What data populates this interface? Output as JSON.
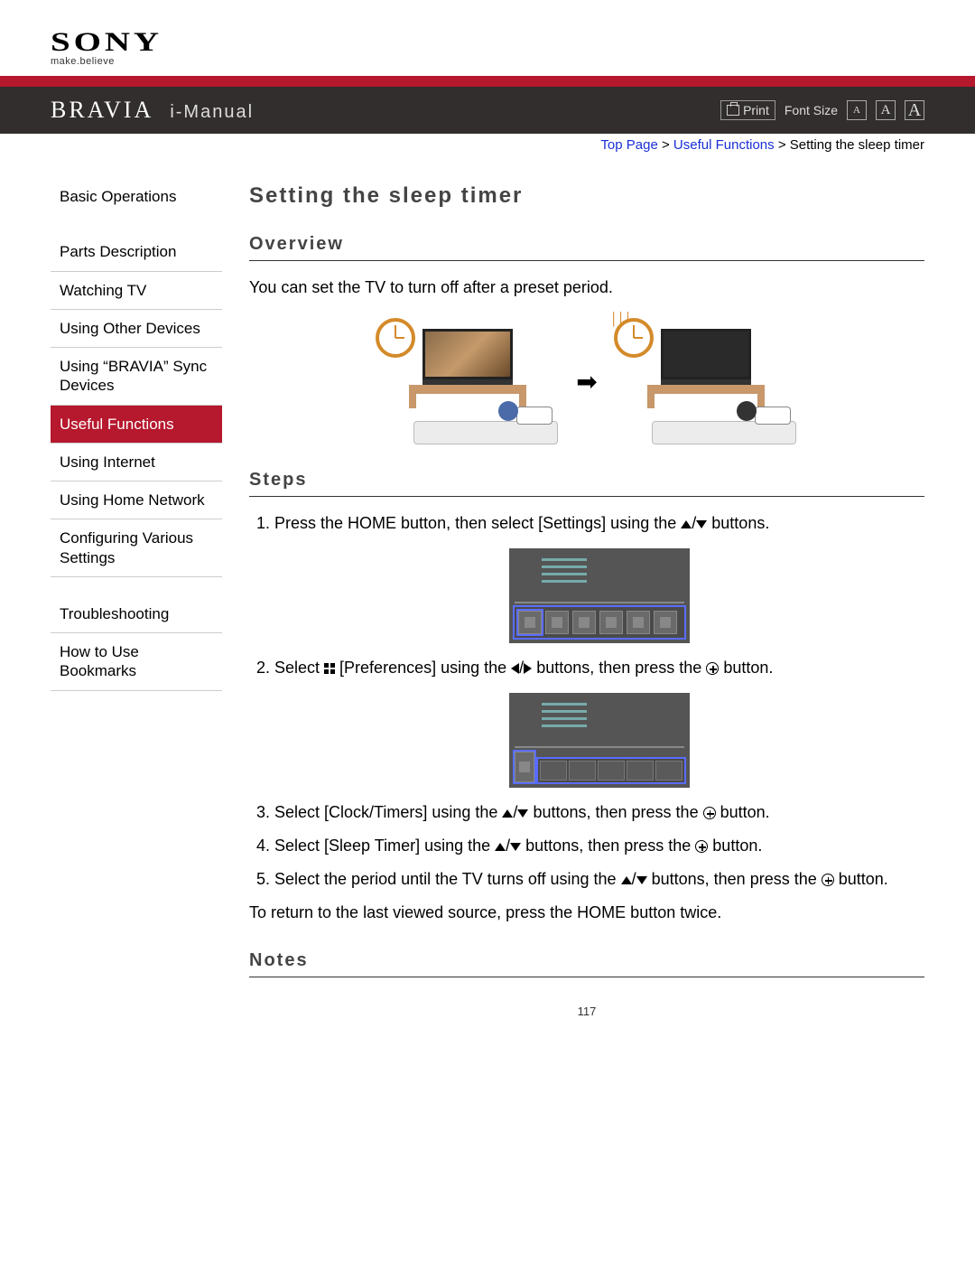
{
  "logo": {
    "brand": "SONY",
    "tagline": "make.believe"
  },
  "header": {
    "product": "BRAVIA",
    "title": "i-Manual",
    "print": "Print",
    "font_size_label": "Font Size",
    "size_small": "A",
    "size_med": "A",
    "size_large": "A"
  },
  "breadcrumb": {
    "top": "Top Page",
    "section": "Useful Functions",
    "current": "Setting the sleep timer",
    "sep": ">"
  },
  "sidebar": {
    "basic": "Basic Operations",
    "items": [
      "Parts Description",
      "Watching TV",
      "Using Other Devices",
      "Using “BRAVIA” Sync Devices",
      "Useful Functions",
      "Using Internet",
      "Using Home Network",
      "Configuring Various Settings"
    ],
    "trouble": "Troubleshooting",
    "bookmarks": "How to Use Bookmarks"
  },
  "main": {
    "title": "Setting the sleep timer",
    "overview_h": "Overview",
    "overview_text": "You can set the TV to turn off after a preset period.",
    "steps_h": "Steps",
    "step1_a": "Press the HOME button, then select [Settings] using the ",
    "step1_b": " buttons.",
    "step2_a": "Select ",
    "step2_b": " [Preferences] using the ",
    "step2_c": " buttons, then press the ",
    "step2_d": " button.",
    "step3_a": "Select [Clock/Timers] using the ",
    "step3_b": " buttons, then press the ",
    "step3_c": " button.",
    "step4_a": "Select [Sleep Timer] using the ",
    "step4_b": " buttons, then press the ",
    "step4_c": " button.",
    "step5_a": "Select the period until the TV turns off using the ",
    "step5_b": " buttons, then press the ",
    "step5_c": " button.",
    "return_text": "To return to the last viewed source, press the HOME button twice.",
    "notes_h": "Notes",
    "slash": "/"
  },
  "page_number": "117"
}
